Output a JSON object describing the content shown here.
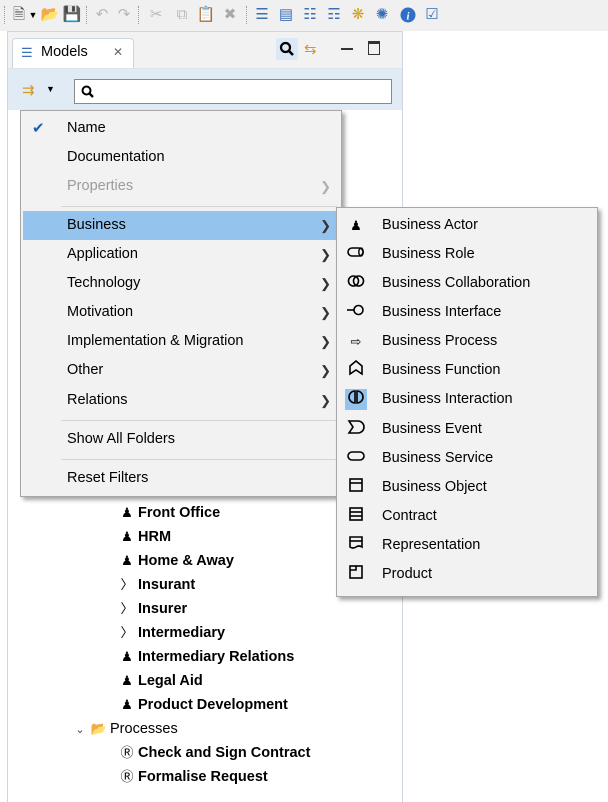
{
  "view": {
    "tab_label": "Models",
    "tab_close": "✕",
    "search_value": "",
    "search_placeholder": ""
  },
  "filter_menu": {
    "items": [
      {
        "label": "Name",
        "checked": true
      },
      {
        "label": "Documentation"
      },
      {
        "label": "Properties",
        "disabled": true,
        "submenu": true
      },
      {
        "label": "Business",
        "submenu": true,
        "selected": true
      },
      {
        "label": "Application",
        "submenu": true
      },
      {
        "label": "Technology",
        "submenu": true
      },
      {
        "label": "Motivation",
        "submenu": true
      },
      {
        "label": "Implementation & Migration",
        "submenu": true
      },
      {
        "label": "Other",
        "submenu": true
      },
      {
        "label": "Relations",
        "submenu": true
      },
      {
        "label": "Show All Folders"
      },
      {
        "label": "Reset Filters"
      }
    ]
  },
  "business_submenu": {
    "items": [
      {
        "label": "Business Actor",
        "icon": "business-actor-icon"
      },
      {
        "label": "Business Role",
        "icon": "business-role-icon"
      },
      {
        "label": "Business Collaboration",
        "icon": "business-collaboration-icon"
      },
      {
        "label": "Business Interface",
        "icon": "business-interface-icon"
      },
      {
        "label": "Business Process",
        "icon": "business-process-icon"
      },
      {
        "label": "Business Function",
        "icon": "business-function-icon"
      },
      {
        "label": "Business Interaction",
        "icon": "business-interaction-icon",
        "highlighted": true
      },
      {
        "label": "Business Event",
        "icon": "business-event-icon"
      },
      {
        "label": "Business Service",
        "icon": "business-service-icon"
      },
      {
        "label": "Business Object",
        "icon": "business-object-icon"
      },
      {
        "label": "Contract",
        "icon": "contract-icon"
      },
      {
        "label": "Representation",
        "icon": "representation-icon"
      },
      {
        "label": "Product",
        "icon": "product-icon"
      }
    ]
  },
  "tree": {
    "items": [
      {
        "label": "Front Office",
        "icon": "business-actor-icon"
      },
      {
        "label": "HRM",
        "icon": "business-actor-icon"
      },
      {
        "label": "Home & Away",
        "icon": "business-actor-icon"
      },
      {
        "label": "Insurant",
        "icon": "business-role-icon"
      },
      {
        "label": "Insurer",
        "icon": "business-role-icon"
      },
      {
        "label": "Intermediary",
        "icon": "business-role-icon"
      },
      {
        "label": "Intermediary Relations",
        "icon": "business-actor-icon"
      },
      {
        "label": "Legal Aid",
        "icon": "business-actor-icon"
      },
      {
        "label": "Product Development",
        "icon": "business-actor-icon"
      }
    ],
    "folder_label": "Processes",
    "processes": [
      {
        "label": "Check and Sign Contract",
        "icon": "business-interaction-icon"
      },
      {
        "label": "Formalise Request",
        "icon": "business-interaction-icon"
      }
    ]
  }
}
